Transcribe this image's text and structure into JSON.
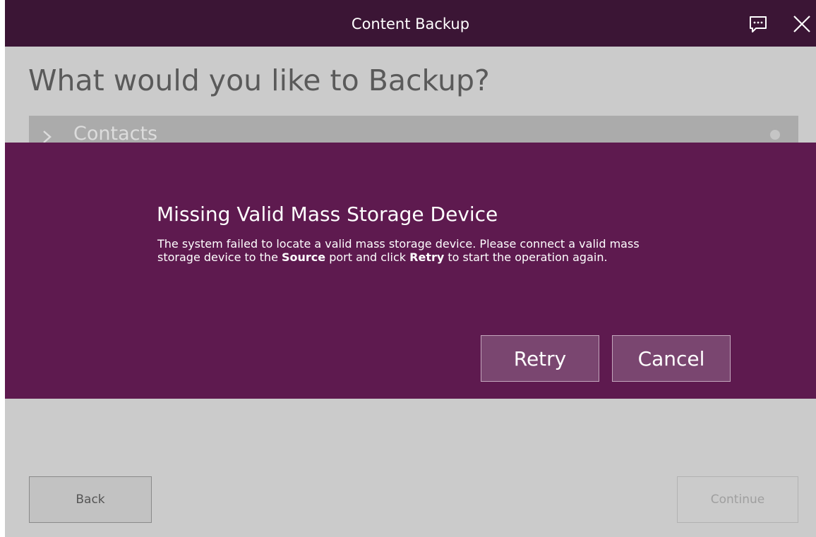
{
  "window": {
    "title": "Content Backup",
    "icons": {
      "feedback": "feedback-chat-icon",
      "close": "close-icon"
    }
  },
  "page": {
    "heading": "What would you like to Backup?",
    "list_items": [
      {
        "label": "Contacts",
        "icon": "chevron-right-icon"
      }
    ]
  },
  "dialog": {
    "title": "Missing Valid Mass Storage Device",
    "message": {
      "part1": "The system failed to locate a valid mass storage device. Please connect a valid mass storage device to the ",
      "source": "Source",
      "part2": " port and click ",
      "retry": "Retry",
      "part3": " to start the operation again."
    },
    "retry_label": "Retry",
    "cancel_label": "Cancel"
  },
  "footer": {
    "back_label": "Back",
    "continue_label": "Continue"
  },
  "colors": {
    "titlebar": "#3b1535",
    "dialog_bg": "#5e1a4f",
    "dialog_button": "#7a4670",
    "page_bg": "#cbcbcb"
  }
}
